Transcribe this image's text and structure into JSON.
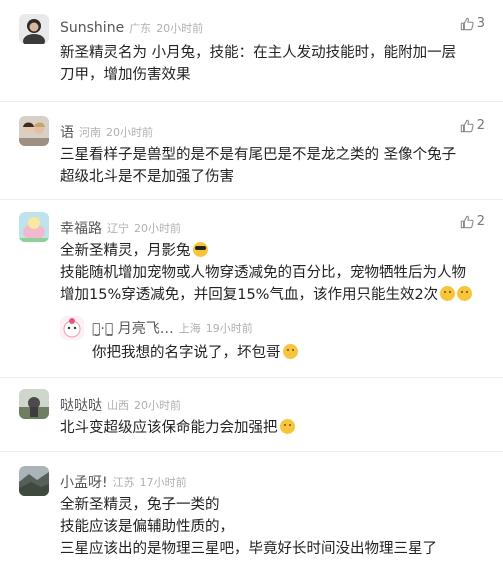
{
  "comments": [
    {
      "name": "Sunshine",
      "location": "广东",
      "time": "20小时前",
      "likes": "3",
      "lines": [
        "新圣精灵名为 小月兔，技能：在主人发动技能时，能附加一层",
        "刀甲，增加伤害效果"
      ]
    },
    {
      "name": "语",
      "location": "河南",
      "time": "20小时前",
      "likes": "2",
      "lines": [
        "三星看样子是兽型的是不是有尾巴是不是龙之类的 圣像个兔子",
        "超级北斗是不是加强了伤害"
      ]
    },
    {
      "name": "幸福路",
      "location": "辽宁",
      "time": "20小时前",
      "likes": "2",
      "lines": [
        "全新圣精灵，月影兔",
        "技能随机增加宠物或人物穿透减免的百分比，宠物牺牲后为人物",
        "增加15%穿透减免，并回复15%气血，该作用只能生效2次"
      ]
    },
    {
      "name": "ꪔ̤̮·ꪔ̤̫ 月亮飞…",
      "location": "上海",
      "time": "19小时前",
      "likes": "",
      "lines": [
        "你把我想的名字说了，坏包哥"
      ]
    },
    {
      "name": "哒哒哒",
      "location": "山西",
      "time": "20小时前",
      "likes": "",
      "lines": [
        "北斗变超级应该保命能力会加强把"
      ]
    },
    {
      "name": "小孟呀!",
      "location": "江苏",
      "time": "17小时前",
      "likes": "",
      "lines": [
        "全新圣精灵，兔子一类的",
        "技能应该是偏辅助性质的，",
        "三星应该出的是物理三星吧，毕竟好长时间没出物理三星了"
      ]
    }
  ],
  "colors": {
    "username": "#555555",
    "meta": "#b0b0b0",
    "text": "#222222",
    "divider": "#ededed"
  }
}
